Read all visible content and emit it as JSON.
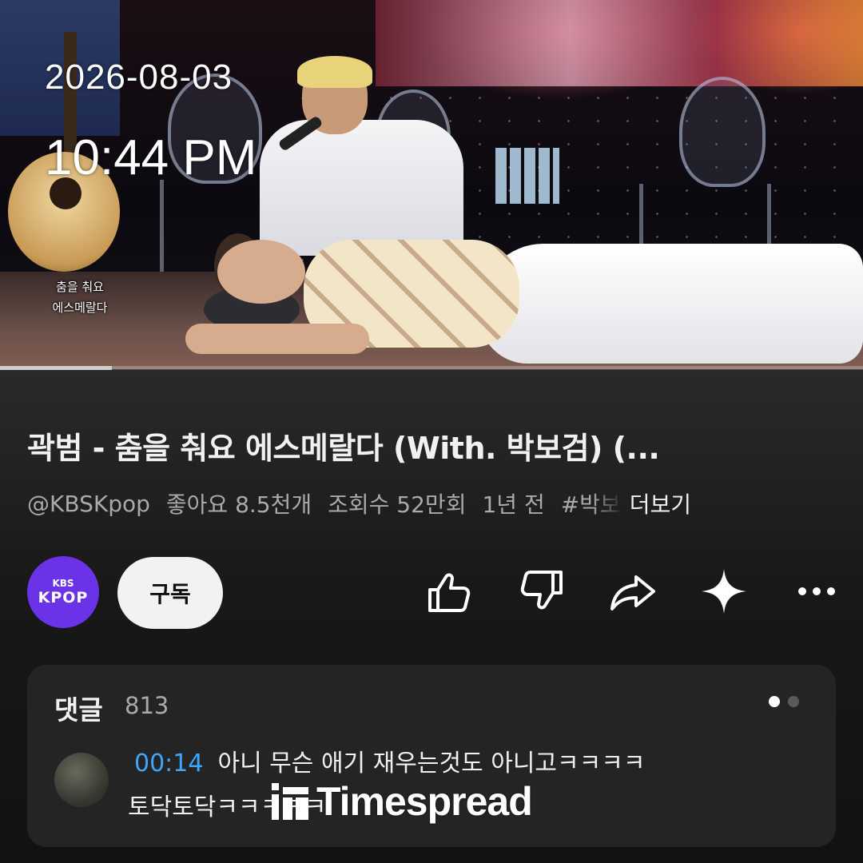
{
  "overlay": {
    "date": "2026-08-03",
    "time": "10:44 PM"
  },
  "video": {
    "caption_line1": "춤을 춰요",
    "caption_line2": "에스메랄다",
    "progress_fraction": 0.13
  },
  "details": {
    "title": "곽범 - 춤을 춰요 에스메랄다 (With. 박보검) (...",
    "channel_handle": "@KBSKpop",
    "likes": "좋아요 8.5천개",
    "views": "조회수 52만회",
    "age": "1년 전",
    "hashtag": "#박보검",
    "more_label": "더보기"
  },
  "channel": {
    "avatar_line1": "KBS",
    "avatar_line2": "KPOP",
    "avatar_color": "#6b33e8",
    "subscribe_label": "구독"
  },
  "actions": [
    {
      "icon": "like-icon"
    },
    {
      "icon": "dislike-icon"
    },
    {
      "icon": "share-icon"
    },
    {
      "icon": "sparkle-icon"
    },
    {
      "icon": "more-icon"
    }
  ],
  "comments": {
    "title": "댓글",
    "count": "813",
    "page_dots": 2,
    "active_dot": 0,
    "top_comment": {
      "timestamp": "00:14",
      "line1": "아니 무슨 애기 재우는것도 아니고ㅋㅋㅋㅋ",
      "line2": "토닥토닥ㅋㅋㅋㅋㅋ"
    }
  },
  "watermark": {
    "text": "Timespread"
  },
  "colors": {
    "background": "#0f0f0f",
    "timestamp_link": "#3ea6ff",
    "subscribe_bg": "#f2f2f2"
  }
}
